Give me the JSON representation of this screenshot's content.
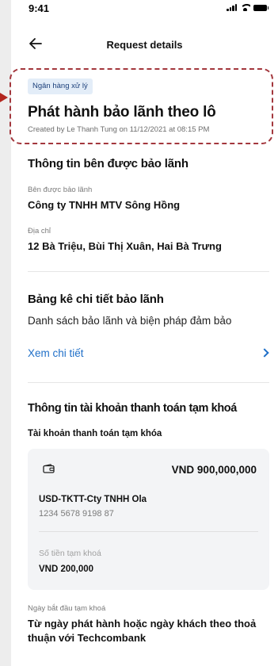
{
  "status_bar": {
    "time": "9:41"
  },
  "nav": {
    "title": "Request details"
  },
  "header": {
    "badge": "Ngân hàng xử lý",
    "title": "Phát hành bảo lãnh theo lô",
    "created_by": "Created by Le Thanh Tung on 11/12/2021 at 08:15 PM"
  },
  "beneficiary": {
    "section_title": "Thông tin bên được bảo lãnh",
    "party_label": "Bên được bảo lãnh",
    "party_value": "Công ty TNHH MTV Sông Hồng",
    "address_label": "Địa chỉ",
    "address_value": "12 Bà Triệu, Bùi Thị Xuân, Hai Bà Trưng"
  },
  "guarantee_list": {
    "section_title": "Bảng kê chi tiết bảo lãnh",
    "subtitle": "Danh sách bảo lãnh và biện pháp đảm bảo",
    "link_label": "Xem chi tiết"
  },
  "account": {
    "section_title": "Thông tin tài khoản thanh toán tạm khoá",
    "subsection_label": "Tài khoản thanh toán tạm khóa",
    "card": {
      "icon": "wallet-icon",
      "balance": "VND 900,000,000",
      "account_name": "USD-TKTT-Cty TNHH Ola",
      "account_number": "1234 5678 9198 87",
      "locked_label": "Số tiền tạm khoá",
      "locked_value": "VND 200,000"
    },
    "start_date_label": "Ngày bắt đầu tạm khoá",
    "start_date_value": "Từ ngày phát hành hoặc ngày khách theo thoả thuận với Techcombank"
  },
  "colors": {
    "accent_link": "#1f6fc8",
    "badge_bg": "#e3edf8",
    "highlight_border": "#a3373d"
  }
}
